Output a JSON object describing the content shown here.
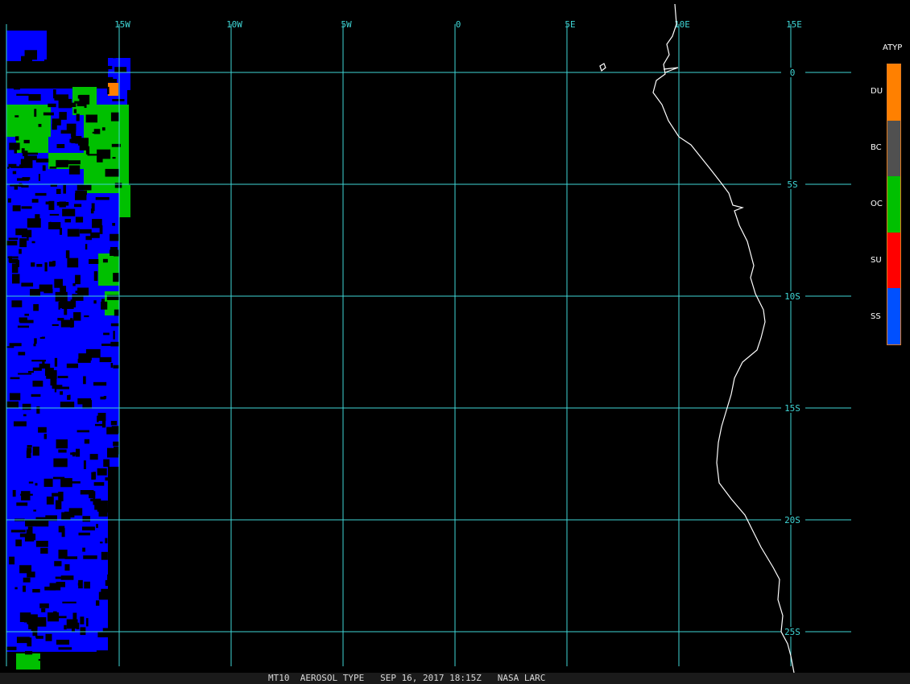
{
  "lon_labels": [
    "15W",
    "10W",
    "5W",
    "0",
    "5E",
    "10E",
    "15E"
  ],
  "lat_labels": [
    "0",
    "5S",
    "10S",
    "15S",
    "20S",
    "25S"
  ],
  "legend": {
    "title": "ATYP",
    "items": [
      {
        "label": "DU",
        "color": "#ff8000"
      },
      {
        "label": "BC",
        "color": "#505050"
      },
      {
        "label": "OC",
        "color": "#00c000"
      },
      {
        "label": "SU",
        "color": "#ff0000"
      },
      {
        "label": "SS",
        "color": "#0050ff"
      }
    ]
  },
  "status": "MT10  AEROSOL TYPE   SEP 16, 2017 18:15Z   NASA LARC",
  "colors": {
    "grid": "#3fd6d6",
    "coast": "#ffffff",
    "land_mask": "#000000"
  }
}
